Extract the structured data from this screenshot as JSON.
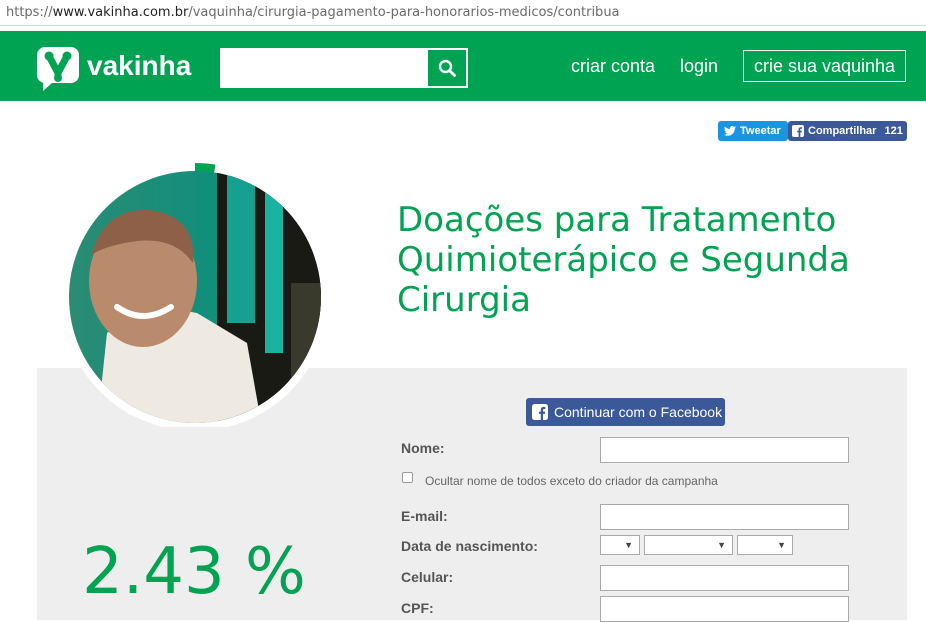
{
  "browser": {
    "url_scheme": "https://",
    "url_host": "www.vakinha.com.br",
    "url_path": "/vaquinha/cirurgia-pagamento-para-honorarios-medicos/contribua"
  },
  "header": {
    "logo_text": "vakinha",
    "search_placeholder": "",
    "search_icon": "search-icon",
    "links": {
      "create_account": "criar conta",
      "login": "login"
    },
    "create_campaign": "crie sua vaquinha",
    "brand_color": "#00a352"
  },
  "share": {
    "tweet_label": "Tweetar",
    "fb_label": "Compartilhar",
    "fb_count": "121",
    "twitter_color": "#1b95e0",
    "facebook_color": "#3b5998"
  },
  "campaign": {
    "title": "Doações para Tratamento Quimioterápico e Segunda Cirurgia",
    "progress_percent": "2.43 %",
    "progress_value": 0.0243
  },
  "form": {
    "facebook_button": "Continuar com o Facebook",
    "name_label": "Nome:",
    "hide_name_label": "Ocultar nome de todos exceto do criador da campanha",
    "email_label": "E-mail:",
    "birthdate_label": "Data de nascimento:",
    "phone_label": "Celular:",
    "cpf_label": "CPF:",
    "name_value": "",
    "email_value": "",
    "phone_value": "",
    "cpf_value": "",
    "birth_day": "",
    "birth_month": "",
    "birth_year": ""
  }
}
